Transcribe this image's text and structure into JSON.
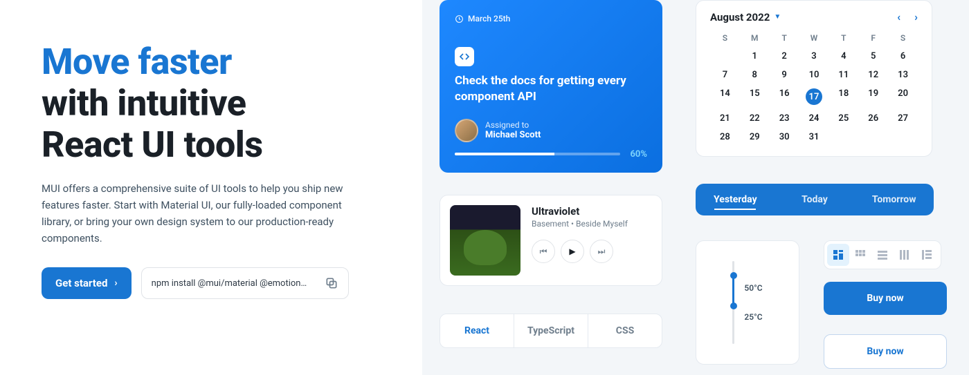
{
  "hero": {
    "title_blue": "Move faster",
    "title_line2": "with intuitive",
    "title_line3": "React UI tools",
    "description": "MUI offers a comprehensive suite of UI tools to help you ship new features faster. Start with Material UI, our fully-loaded component library, or bring your own design system to our production-ready components.",
    "cta_label": "Get started",
    "npm_command": "npm install @mui/material @emotion…"
  },
  "task": {
    "date": "March 25th",
    "title": "Check the docs for getting every component API",
    "assigned_label": "Assigned to",
    "assigned_name": "Michael Scott",
    "progress_pct": "60%"
  },
  "calendar": {
    "month_label": "August 2022",
    "dow": [
      "S",
      "M",
      "T",
      "W",
      "T",
      "F",
      "S"
    ],
    "days": [
      "",
      "1",
      "2",
      "3",
      "4",
      "5",
      "6",
      "7",
      "8",
      "9",
      "10",
      "11",
      "12",
      "13",
      "14",
      "15",
      "16",
      "17",
      "18",
      "19",
      "20",
      "21",
      "22",
      "23",
      "24",
      "25",
      "26",
      "27",
      "28",
      "29",
      "30",
      "31"
    ],
    "selected": "17"
  },
  "music": {
    "title": "Ultraviolet",
    "subtitle": "Basement • Beside Myself"
  },
  "tabs": [
    "Yesterday",
    "Today",
    "Tomorrow"
  ],
  "chips": [
    "React",
    "TypeScript",
    "CSS"
  ],
  "slider": {
    "high": "50°C",
    "low": "25°C"
  },
  "buy": {
    "label": "Buy now"
  }
}
